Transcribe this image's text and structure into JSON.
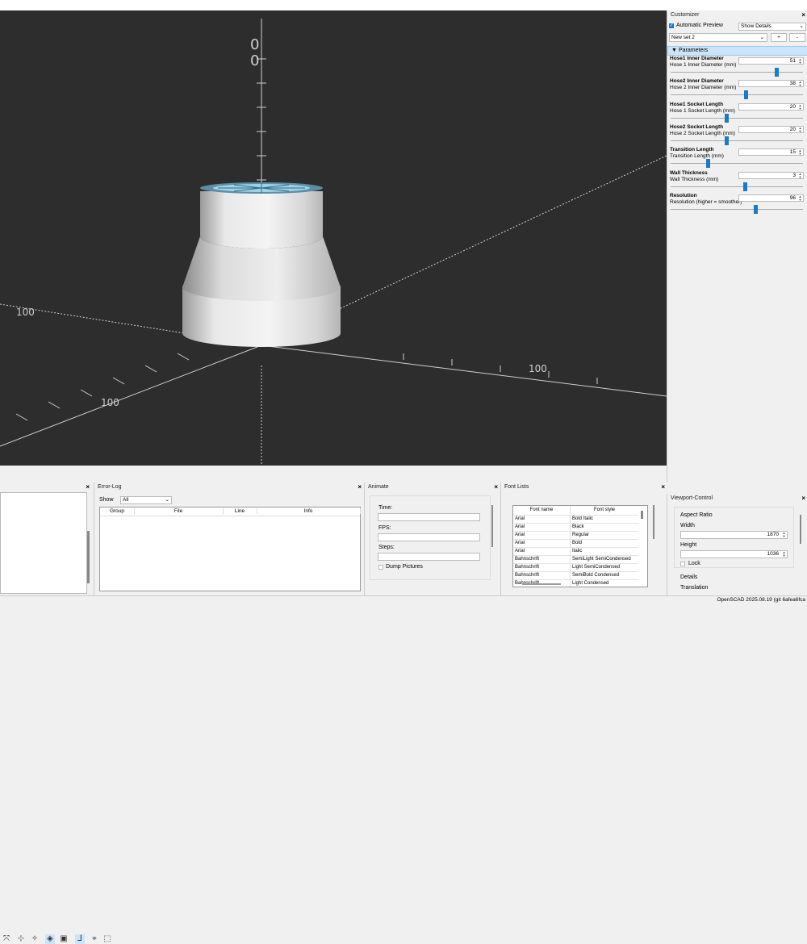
{
  "viewport": {
    "axis_labels": {
      "y_top": "0",
      "y_top2": "0",
      "x_left": "100",
      "x_right": "100",
      "y_front": "100"
    }
  },
  "customizer": {
    "title": "Customizer",
    "auto_preview_label": "Automatic Preview",
    "auto_preview_checked": true,
    "show_details_value": "Show Details",
    "preset_value": "New set 2",
    "add_label": "+",
    "remove_label": "-",
    "section_label": "Parameters",
    "params": [
      {
        "name": "Hose1 Inner Diameter",
        "desc": "Hose 1 Inner Diameter (mm)",
        "value": "51",
        "slider_fraction": 0.8
      },
      {
        "name": "Hose2 Inner Diameter",
        "desc": "Hose 2 Inner Diameter (mm)",
        "value": "38",
        "slider_fraction": 0.57
      },
      {
        "name": "Hose1 Socket Length",
        "desc": "Hose 1 Socket Length (mm)",
        "value": "20",
        "slider_fraction": 0.42
      },
      {
        "name": "Hose2 Socket Length",
        "desc": "Hose 2 Socket Length (mm)",
        "value": "20",
        "slider_fraction": 0.42
      },
      {
        "name": "Transition Length",
        "desc": "Transition Length (mm)",
        "value": "15",
        "slider_fraction": 0.28
      },
      {
        "name": "Wall Thickness",
        "desc": "Wall Thickness (mm)",
        "value": "3",
        "slider_fraction": 0.56
      },
      {
        "name": "Resolution",
        "desc": "Resolution (higher = smoother)",
        "value": "96",
        "slider_fraction": 0.64
      }
    ]
  },
  "error_log": {
    "title": "Error-Log",
    "show_label": "Show",
    "show_value": "All",
    "columns": [
      "Group",
      "File",
      "Line",
      "Info"
    ]
  },
  "animate": {
    "title": "Animate",
    "time_label": "Time:",
    "fps_label": "FPS:",
    "steps_label": "Steps:",
    "dump_label": "Dump Pictures"
  },
  "font_lists": {
    "title": "Font Lists",
    "columns": [
      "Font name",
      "Font style"
    ],
    "rows": [
      [
        "Arial",
        "Bold Italic"
      ],
      [
        "Arial",
        "Black"
      ],
      [
        "Arial",
        "Regular"
      ],
      [
        "Arial",
        "Bold"
      ],
      [
        "Arial",
        "Italic"
      ],
      [
        "Bahnschrift",
        "SemiLight SemiCondensed"
      ],
      [
        "Bahnschrift",
        "Light SemiCondensed"
      ],
      [
        "Bahnschrift",
        "SemiBold Condensed"
      ],
      [
        "Bahnschrift",
        "Light Condensed"
      ]
    ]
  },
  "viewport_control": {
    "title": "Viewport-Control",
    "aspect_label": "Aspect Ratio",
    "width_label": "Width",
    "width_value": "1870",
    "height_label": "Height",
    "height_value": "1036",
    "lock_label": "Lock",
    "details_label": "Details",
    "translation_label": "Translation"
  },
  "status": {
    "version": "OpenSCAD 2025.08.19 (git 6afea6fca"
  },
  "colors": {
    "viewport_bg": "#2d2d2d",
    "accent": "#1b79c9",
    "selected_section": "#cce4f7"
  }
}
